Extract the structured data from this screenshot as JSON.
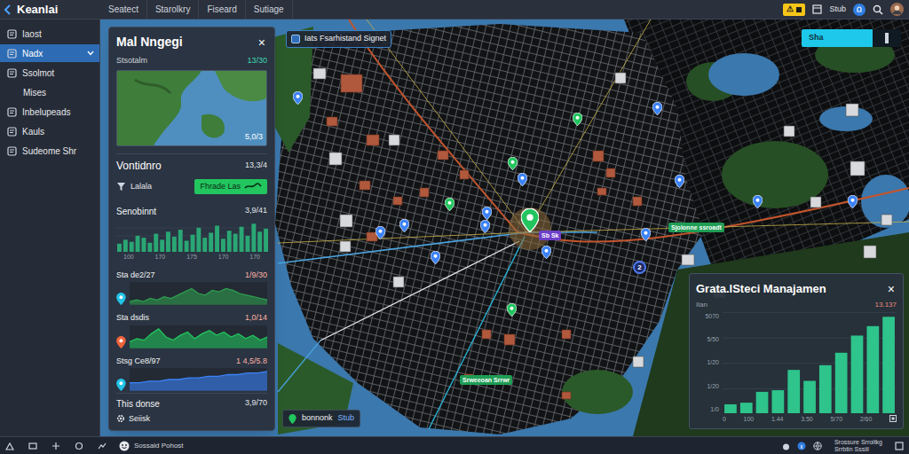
{
  "window": {
    "title": "Keanlai"
  },
  "tabs": [
    {
      "label": "Seatect",
      "selected": false
    },
    {
      "label": "Starolkry",
      "selected": false
    },
    {
      "label": "Fiseard",
      "selected": false
    },
    {
      "label": "Sutiage",
      "selected": false
    }
  ],
  "topbar": {
    "badge": "⚠",
    "user": "Stub"
  },
  "sidebar": {
    "items": [
      {
        "label": "Iaost",
        "kind": "item",
        "selected": false
      },
      {
        "label": "Nadx",
        "kind": "item",
        "selected": true
      },
      {
        "label": "Ssolmot",
        "kind": "item",
        "selected": false
      },
      {
        "label": "Mises",
        "kind": "sub",
        "selected": false
      },
      {
        "label": "Inbelupeads",
        "kind": "item",
        "selected": false
      },
      {
        "label": "Kauls",
        "kind": "item",
        "selected": false
      },
      {
        "label": "Sudeome Shr",
        "kind": "item",
        "selected": false
      }
    ]
  },
  "left_panel": {
    "title": "Mal Nngegi",
    "close": "×",
    "stat": {
      "label": "Stsotalm",
      "value": "13/30"
    },
    "thumb_value": "5,0/3",
    "summary": {
      "label": "Vontidnro",
      "value": "13,3/4"
    },
    "filter": {
      "label": "Lalala",
      "button": "Fhrade Las"
    },
    "bars": {
      "label": "Senobinnt",
      "value": "3,9/41",
      "values": [
        8,
        12,
        10,
        16,
        14,
        9,
        18,
        12,
        20,
        15,
        22,
        11,
        17,
        24,
        14,
        19,
        26,
        13,
        21,
        18,
        25,
        16,
        28,
        20,
        23
      ],
      "ticks": [
        "100",
        "170",
        "175",
        "170",
        "170"
      ]
    },
    "series": [
      {
        "label": "Sta de2/27",
        "value": "1/9/30",
        "values": [
          2,
          3,
          2,
          4,
          3,
          5,
          4,
          6,
          8,
          10,
          7,
          6,
          9,
          8,
          10,
          9,
          7,
          6,
          5,
          4,
          3
        ],
        "color": "#2e9e4f",
        "pin_color": "#22c3e6"
      },
      {
        "label": "Sta dsdis",
        "value": "1,0/14",
        "values": [
          4,
          6,
          5,
          9,
          12,
          7,
          5,
          8,
          10,
          6,
          9,
          11,
          8,
          10,
          7,
          9,
          6,
          8,
          5,
          7
        ],
        "color": "#22c55e",
        "pin_color": "#f0643c"
      },
      {
        "label": "Stsg Ce8/97",
        "value": "1 4,5/5.8",
        "values": [
          5,
          5,
          6,
          6,
          7,
          7,
          8,
          8,
          9,
          9,
          10,
          10,
          11,
          11,
          12
        ],
        "color": "#3b82f6",
        "pin_color": "#22c3e6"
      }
    ],
    "footer": {
      "label": "This donse",
      "value": "3,9/70",
      "link": "Seiisk"
    }
  },
  "map": {
    "search": "Iats Fsarhistand Signet",
    "toggle": "Sha",
    "numbered_pin": "2",
    "labels": [
      {
        "text": "Sjolonne ssroadt",
        "color": "#1f9d55"
      },
      {
        "text": "Srweeoan Srrwr",
        "color": "#1f9d55"
      },
      {
        "text": "Sb Sk",
        "color": "#6d3fc9"
      }
    ],
    "pins": [
      {
        "kind": "main",
        "color": "#22c55e"
      },
      {
        "kind": "pin",
        "color": "#22c55e"
      },
      {
        "kind": "pin",
        "color": "#3b82f6"
      },
      {
        "kind": "pin",
        "color": "#22c55e"
      },
      {
        "kind": "pin",
        "color": "#3b82f6"
      },
      {
        "kind": "pin",
        "color": "#3b82f6"
      },
      {
        "kind": "pin",
        "color": "#3b82f6"
      },
      {
        "kind": "pin",
        "color": "#3b82f6"
      },
      {
        "kind": "pin",
        "color": "#3b82f6"
      },
      {
        "kind": "pin",
        "color": "#22c55e"
      },
      {
        "kind": "pin",
        "color": "#22c55e"
      },
      {
        "kind": "pin",
        "color": "#3b82f6"
      },
      {
        "kind": "pin",
        "color": "#3b82f6"
      },
      {
        "kind": "pin",
        "color": "#3b82f6"
      },
      {
        "kind": "pin",
        "color": "#3b82f6"
      },
      {
        "kind": "pin",
        "color": "#3b82f6"
      },
      {
        "kind": "pin",
        "color": "#3b82f6"
      },
      {
        "kind": "pin",
        "color": "#3b82f6"
      }
    ]
  },
  "bottom_chip": {
    "label": "bonnonk",
    "value": "Stub"
  },
  "right_panel": {
    "title": "Grata.lSteci Manajamen",
    "close": "×",
    "axis_title": "Ilan",
    "total": "13.137",
    "y_ticks": [
      "5070",
      "5/50",
      "1/20",
      "1/20",
      "1/0"
    ],
    "x_ticks": [
      "0",
      "100",
      "1.44",
      "3.50",
      "5/70",
      "2/60"
    ],
    "values": [
      12,
      14,
      28,
      30,
      56,
      42,
      62,
      78,
      100,
      112,
      124
    ]
  },
  "status_bar": {
    "text": "Sossald Pohost",
    "right_lines": [
      "Srossure Srroitkg",
      "Srrbtin Sssiil"
    ]
  }
}
